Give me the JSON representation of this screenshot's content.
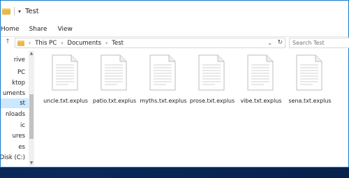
{
  "window": {
    "title": "Test",
    "dropdown_glyph": "▾"
  },
  "ribbon": {
    "tabs": [
      "Home",
      "Share",
      "View"
    ]
  },
  "address": {
    "crumbs": [
      "This PC",
      "Documents",
      "Test"
    ],
    "separator": "›",
    "back_icon": "←",
    "forward_icon": "→",
    "dropdown_icon": "⌄",
    "refresh_icon": "↻"
  },
  "search": {
    "placeholder": "Search Test"
  },
  "navpane": {
    "items": [
      {
        "label": "rive",
        "selected": false
      },
      {
        "label": "PC",
        "selected": false
      },
      {
        "label": "ktop",
        "selected": false
      },
      {
        "label": "uments",
        "selected": false
      },
      {
        "label": "st",
        "selected": true
      },
      {
        "label": "nloads",
        "selected": false
      },
      {
        "label": "ic",
        "selected": false
      },
      {
        "label": "ures",
        "selected": false
      },
      {
        "label": "es",
        "selected": false
      },
      {
        "label": "al Disk (C:)",
        "selected": false
      }
    ],
    "scroll_up_icon": "▲",
    "scroll_down_icon": "▼"
  },
  "files": [
    {
      "name": "uncle.txt.explus"
    },
    {
      "name": "patio.txt.explus"
    },
    {
      "name": "myths.txt.explus"
    },
    {
      "name": "prose.txt.explus"
    },
    {
      "name": "vibe.txt.explus"
    },
    {
      "name": "sena.txt.explus"
    }
  ],
  "colors": {
    "selected_bg": "#cce8ff",
    "folder": "#e8b84a",
    "desktop": "#1565c0"
  }
}
